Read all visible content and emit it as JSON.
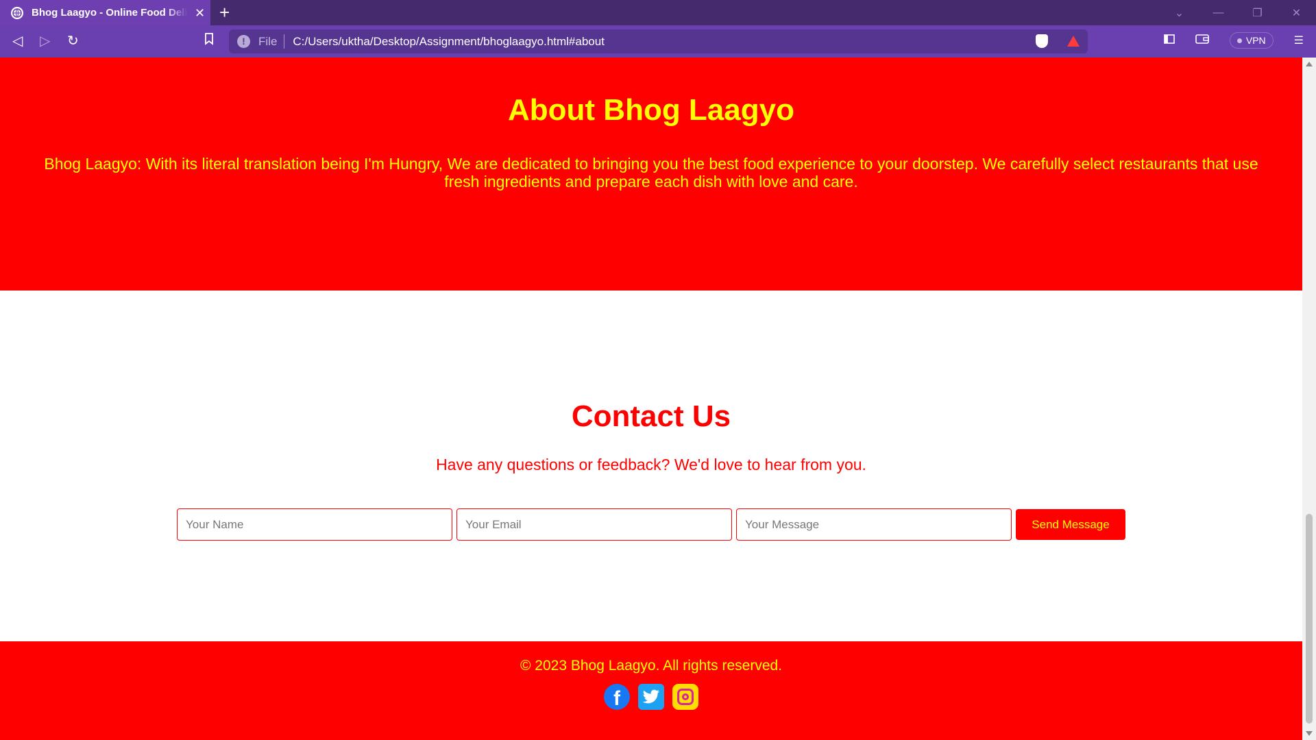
{
  "browser": {
    "tab_title": "Bhog Laagyo - Online Food Delivery",
    "new_tab_label": "+",
    "url_scheme": "File",
    "url": "C:/Users/uktha/Desktop/Assignment/bhoglaagyo.html#about",
    "vpn_label": "VPN",
    "accent_color": "#6a40b0"
  },
  "about": {
    "title": "About Bhog Laagyo",
    "description": "Bhog Laagyo: With its literal translation being I'm Hungry, We are dedicated to bringing you the best food experience to your doorstep. We carefully select restaurants that use fresh ingredients and prepare each dish with love and care."
  },
  "contact": {
    "title": "Contact Us",
    "subtitle": "Have any questions or feedback? We'd love to hear from you.",
    "name_placeholder": "Your Name",
    "email_placeholder": "Your Email",
    "message_placeholder": "Your Message",
    "send_label": "Send Message"
  },
  "footer": {
    "copyright": "© 2023 Bhog Laagyo. All rights reserved.",
    "social": [
      "facebook-icon",
      "twitter-icon",
      "instagram-icon"
    ]
  },
  "colors": {
    "brand_red": "#ff0000",
    "brand_yellow": "#ffff00"
  }
}
